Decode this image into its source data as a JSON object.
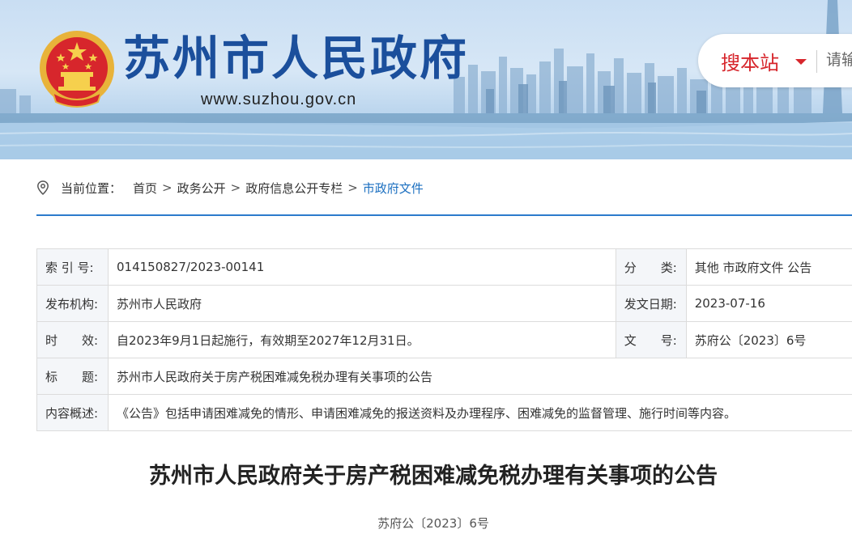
{
  "header": {
    "site_title": "苏州市人民政府",
    "site_url": "www.suzhou.gov.cn",
    "search_scope": "搜本站",
    "search_placeholder": "请输"
  },
  "breadcrumb": {
    "prefix": "当前位置：",
    "items": [
      "首页",
      "政务公开",
      "政府信息公开专栏",
      "市政府文件"
    ],
    "separator": ">"
  },
  "info": {
    "index_label": "索 引 号:",
    "index_value": "014150827/2023-00141",
    "category_label": "分　　类:",
    "category_value": "其他 市政府文件 公告",
    "publisher_label": "发布机构:",
    "publisher_value": "苏州市人民政府",
    "date_label": "发文日期:",
    "date_value": "2023-07-16",
    "validity_label": "时　　效:",
    "validity_value": "自2023年9月1日起施行，有效期至2027年12月31日。",
    "docno_label": "文　　号:",
    "docno_value": "苏府公〔2023〕6号",
    "title_label": "标　　题:",
    "title_value": "苏州市人民政府关于房产税困难减免税办理有关事项的公告",
    "summary_label": "内容概述:",
    "summary_value": "《公告》包括申请困难减免的情形、申请困难减免的报送资料及办理程序、困难减免的监督管理、施行时间等内容。"
  },
  "article": {
    "title": "苏州市人民政府关于房产税困难减免税办理有关事项的公告",
    "doc_number": "苏府公〔2023〕6号"
  },
  "colors": {
    "brand_blue": "#1b4f9c",
    "accent_red": "#d7262c",
    "link_blue": "#1b6fc0",
    "divider_blue": "#2c7bcc"
  }
}
